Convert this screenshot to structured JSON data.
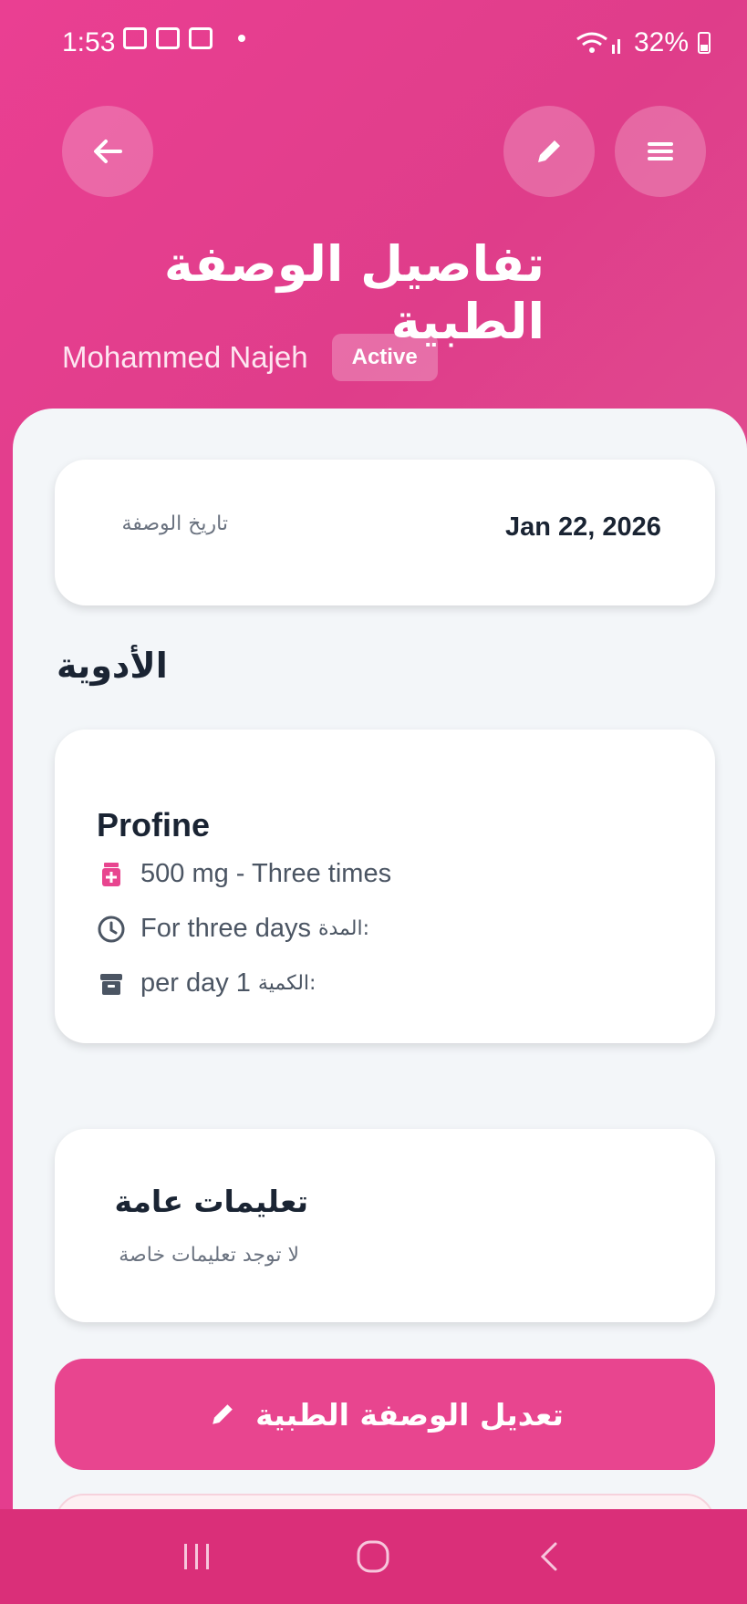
{
  "status_bar": {
    "time": "1:53",
    "battery": "32%"
  },
  "header": {
    "title": "تفاصيل الوصفة الطبية",
    "patient_name": "Mohammed Najeh",
    "status_badge": "Active"
  },
  "date_card": {
    "label": "تاريخ الوصفة",
    "value": "Jan 22, 2026"
  },
  "medications_section": {
    "title": "الأدوية"
  },
  "medication": {
    "name": "Profine",
    "dosage": "500 mg - Three times",
    "duration_label": "المدة:",
    "duration_value": "For three days",
    "quantity_label": "الكمية:",
    "quantity_value": "per day 1"
  },
  "notes_card": {
    "title": "تعليمات عامة",
    "text": "لا توجد تعليمات خاصة"
  },
  "edit_button": {
    "label": "تعديل الوصفة الطبية"
  },
  "icons": {
    "back": "arrow-left-icon",
    "edit": "pencil-icon",
    "menu": "hamburger-menu-icon",
    "pill": "medicine-bottle-icon",
    "clock": "clock-icon",
    "box": "archive-box-icon",
    "nav_recent": "recent-apps-icon",
    "nav_home": "home-icon",
    "nav_back": "chevron-left-icon"
  },
  "colors": {
    "primary": "#e43d8e",
    "button": "#e8458f",
    "nav_bar": "#da2f79"
  }
}
